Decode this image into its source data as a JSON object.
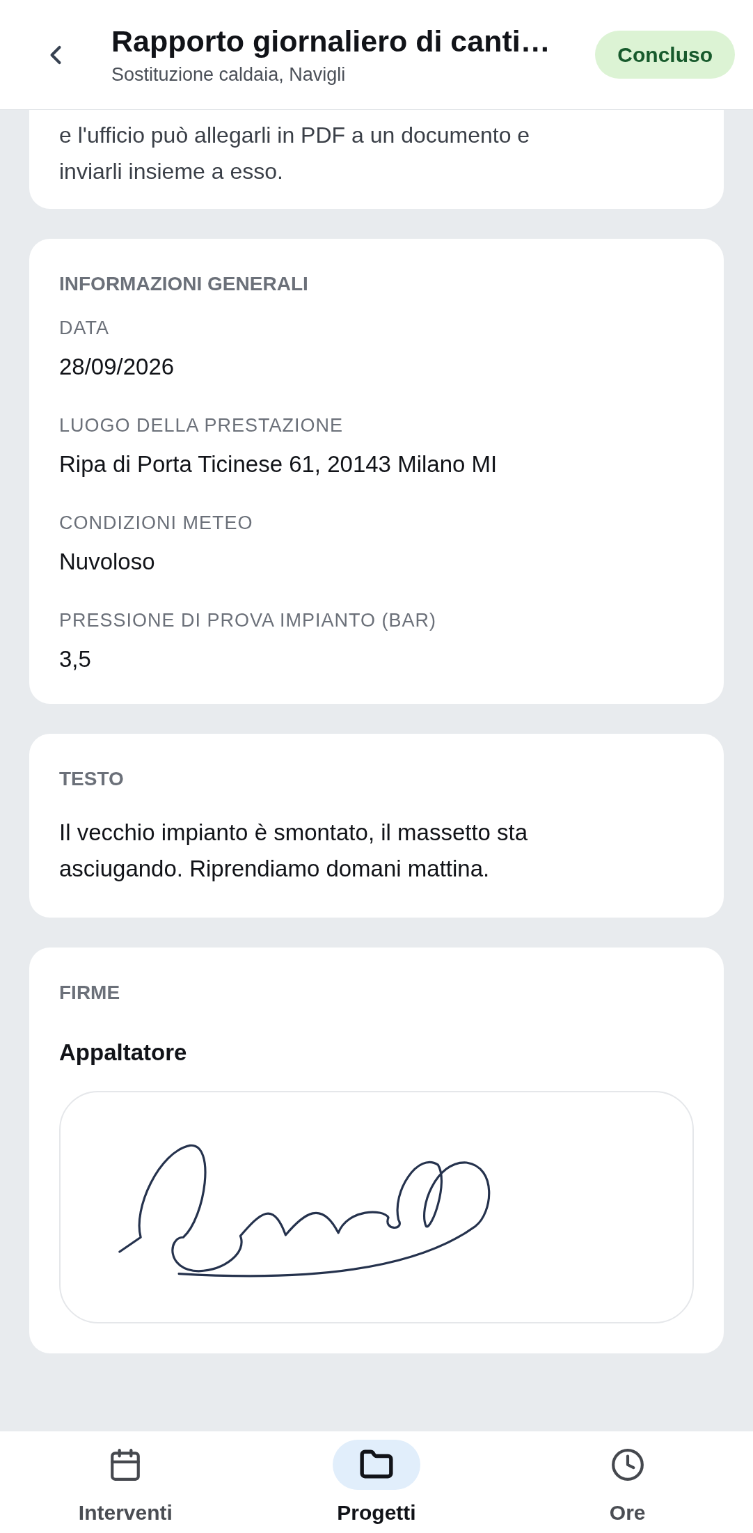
{
  "header": {
    "title": "Rapporto giornaliero di canti…",
    "subtitle": "Sostituzione caldaia, Navigli",
    "status": "Concluso"
  },
  "intro": {
    "lines": [
      "e l'ufficio può allegarli in PDF a un documento e",
      "inviarli insieme a esso."
    ]
  },
  "general": {
    "heading": "INFORMAZIONI GENERALI",
    "fields": [
      {
        "label": "DATA",
        "value": "28/09/2026"
      },
      {
        "label": "LUOGO DELLA PRESTAZIONE",
        "value": "Ripa di Porta Ticinese 61, 20143 Milano MI"
      },
      {
        "label": "CONDIZIONI METEO",
        "value": "Nuvoloso"
      },
      {
        "label": "PRESSIONE DI PROVA IMPIANTO (BAR)",
        "value": "3,5"
      }
    ]
  },
  "text_section": {
    "heading": "TESTO",
    "body": "Il vecchio impianto è smontato, il massetto sta asciugando. Riprendiamo domani mattina."
  },
  "signatures": {
    "heading": "FIRME",
    "items": [
      {
        "role": "Appaltatore",
        "signed": true
      }
    ]
  },
  "nav": [
    {
      "label": "Interventi",
      "selected": false
    },
    {
      "label": "Progetti",
      "selected": true
    },
    {
      "label": "Ore",
      "selected": false
    }
  ]
}
